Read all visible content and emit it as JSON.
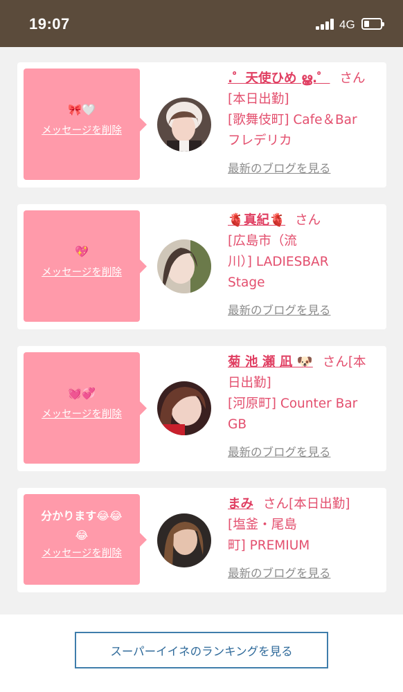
{
  "status_bar": {
    "time": "19:07",
    "network": "4G",
    "signal_icon": "cellular-signal-icon",
    "battery_icon": "battery-icon",
    "battery_level": 0.25
  },
  "cards": [
    {
      "message": "🎀🤍",
      "delete_label": "メッセージを削除",
      "name": ".゜天使ひめ ൠ.゜",
      "san": "さん",
      "lines": [
        "[本日出勤]",
        "[歌舞伎町] Cafe＆Bar",
        "フレデリカ"
      ],
      "blog_label": "最新のブログを見る"
    },
    {
      "message": "💖",
      "delete_label": "メッセージを削除",
      "name": "🫀真紀🫀",
      "san": "さん",
      "lines": [
        "[広島市（流",
        "川）] LADIESBAR",
        "Stage"
      ],
      "blog_label": "最新のブログを見る"
    },
    {
      "message": "💓💞",
      "delete_label": "メッセージを削除",
      "name": "菊 池 瀬 凪 🐶",
      "san": "さん[本",
      "lines": [
        "日出勤]",
        "[河原町] Counter Bar",
        "GB"
      ],
      "blog_label": "最新のブログを見る"
    },
    {
      "message": "分かります😂😂",
      "message2": "😂",
      "delete_label": "メッセージを削除",
      "name": "まみ",
      "san": "さん[本日出勤]",
      "lines": [
        "[塩釜・尾島",
        "町] PREMIUM"
      ],
      "blog_label": "最新のブログを見る"
    }
  ],
  "footer": {
    "ranking_button": "スーパーイイネのランキングを見る"
  },
  "colors": {
    "status_bar": "#5b4b3b",
    "bubble": "#ff9aaa",
    "name_text": "#e03f62",
    "link_gray": "#8c8c8c",
    "button_border": "#3f7dab"
  }
}
